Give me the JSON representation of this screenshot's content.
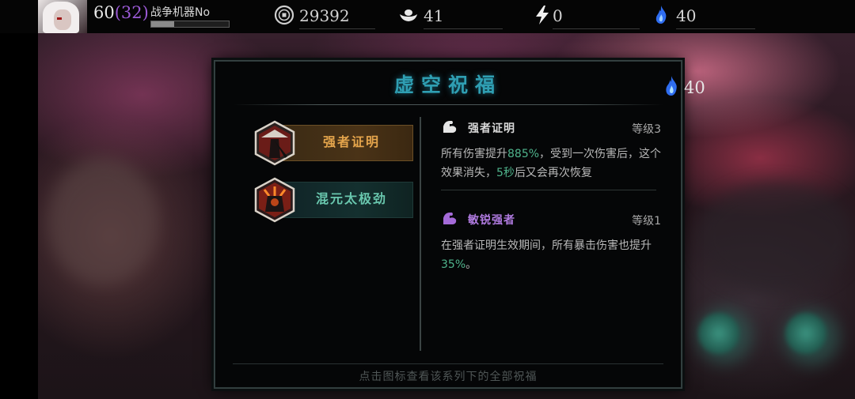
{
  "header": {
    "level": "60",
    "level_bonus": "(32)",
    "player_name": "战争机器No",
    "xp_progress": 0.3,
    "coins": "29392",
    "ingots": "41",
    "energy": "0",
    "blue_flame": "40"
  },
  "dialog": {
    "title": "虚空祝福",
    "flame_count": "40",
    "footer_hint": "点击图标查看该系列下的全部祝福",
    "skills": [
      {
        "name": "强者证明",
        "selected": true
      },
      {
        "name": "混元太极劲",
        "selected": false
      }
    ],
    "buffs": [
      {
        "name": "强者证明",
        "level": "等级3",
        "desc_pre": "所有伤害提升",
        "desc_hl1": "885%",
        "desc_mid": "，受到一次伤害后，这个效果消失，",
        "desc_hl2": "5秒",
        "desc_post": "后又会再次恢复",
        "name_color": "#d9d9d9"
      },
      {
        "name": "敏锐强者",
        "level": "等级1",
        "desc_pre": "在强者证明生效期间，所有暴击伤害也提升",
        "desc_hl1": "35%",
        "desc_post": "。",
        "name_color": "#b07be0"
      }
    ]
  },
  "colors": {
    "accent_cyan": "#2f9fb3",
    "highlight_green": "#4fb48c",
    "gold": "#e5a54c",
    "purple": "#9b5ad6"
  },
  "icons": [
    "coin-icon",
    "ingot-icon",
    "lightning-icon",
    "blue-flame-icon",
    "muscle-arm-icon"
  ]
}
